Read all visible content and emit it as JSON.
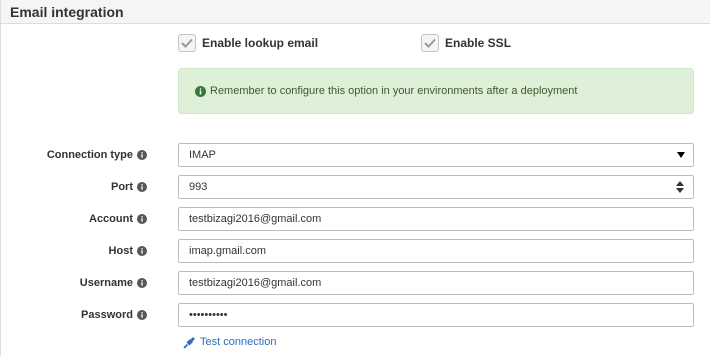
{
  "panel": {
    "title": "Email integration"
  },
  "options": {
    "lookup_email": {
      "label": "Enable lookup email",
      "checked": true
    },
    "ssl": {
      "label": "Enable SSL",
      "checked": true
    }
  },
  "alert": {
    "message": "Remember to configure this option in your environments after a deployment",
    "color": "#dff0d8",
    "icon": "info-circle-icon"
  },
  "form": {
    "connection_type": {
      "label": "Connection type",
      "value": "IMAP"
    },
    "port": {
      "label": "Port",
      "value": "993"
    },
    "account": {
      "label": "Account",
      "value": "testbizagi2016@gmail.com"
    },
    "host": {
      "label": "Host",
      "value": "imap.gmail.com"
    },
    "username": {
      "label": "Username",
      "value": "testbizagi2016@gmail.com"
    },
    "password": {
      "label": "Password",
      "value": "••••••••••"
    }
  },
  "test_connection": {
    "label": "Test connection",
    "icon": "plug-icon",
    "color": "#2a6ebb"
  }
}
